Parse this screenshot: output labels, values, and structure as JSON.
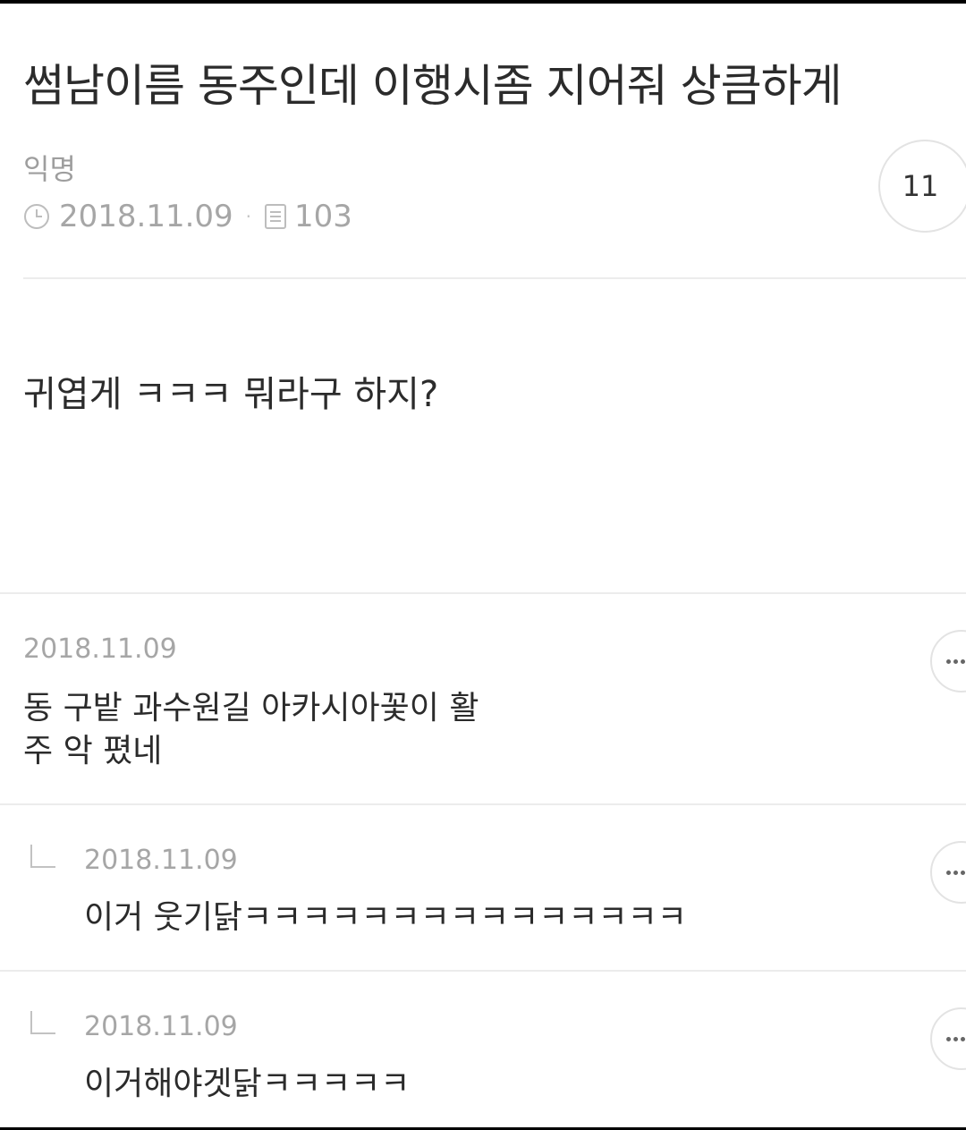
{
  "post": {
    "title": "썸남이름 동주인데 이행시좀 지어줘 상큼하게",
    "author": "익명",
    "date": "2018.11.09",
    "views": "103",
    "like_count": "11",
    "body": "귀엽게 ㅋㅋㅋ 뭐라구 하지?"
  },
  "comments": [
    {
      "date": "2018.11.09",
      "lines": [
        "동 구밭 과수원길 아카시아꽃이 활",
        "주 악 폈네"
      ]
    },
    {
      "date": "2018.11.09",
      "text": "이거 웃기닭ㅋㅋㅋㅋㅋㅋㅋㅋㅋㅋㅋㅋㅋㅋㅋ",
      "is_reply": true
    },
    {
      "date": "2018.11.09",
      "text": "이거해야겟닭ㅋㅋㅋㅋㅋ",
      "is_reply": true
    }
  ],
  "icons": {
    "date": "clock-icon",
    "views": "document-icon",
    "more": "more-dots-icon",
    "reply": "reply-arrow-icon"
  }
}
